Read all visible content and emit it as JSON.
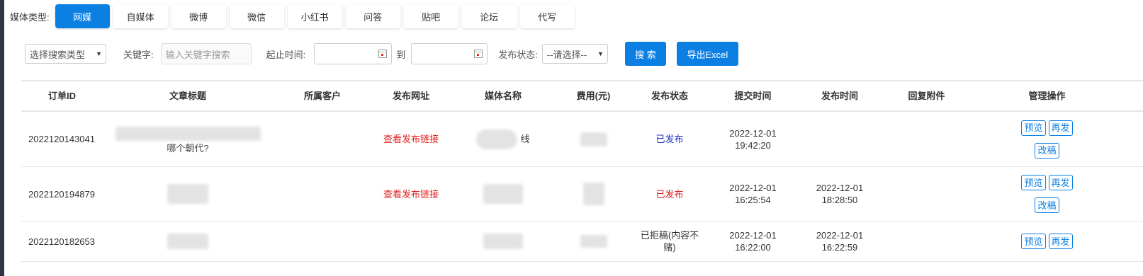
{
  "media": {
    "label": "媒体类型:",
    "tabs": [
      {
        "label": "网媒",
        "active": true
      },
      {
        "label": "自媒体"
      },
      {
        "label": "微博"
      },
      {
        "label": "微信"
      },
      {
        "label": "小红书"
      },
      {
        "label": "问答"
      },
      {
        "label": "贴吧"
      },
      {
        "label": "论坛"
      },
      {
        "label": "代写"
      }
    ]
  },
  "filters": {
    "search_type": "选择搜索类型",
    "keyword_label": "关键字:",
    "keyword_placeholder": "输入关键字搜索",
    "time_label": "起止时间:",
    "to_label": "到",
    "status_label": "发布状态:",
    "status_select": "--请选择--",
    "search_button": "搜 索",
    "export_button": "导出Excel"
  },
  "table": {
    "headers": [
      "订单ID",
      "文章标题",
      "所属客户",
      "发布网址",
      "媒体名称",
      "费用(元)",
      "发布状态",
      "提交时间",
      "发布时间",
      "回复附件",
      "管理操作"
    ],
    "rows": [
      {
        "id": "2022120143041",
        "title_fragment": "哪个朝代?",
        "url_link": "查看发布链接",
        "media_fragment": "线",
        "status": "已发布",
        "submit_date": "2022-12-01",
        "submit_time": "19:42:20",
        "publish_date": "",
        "publish_time": "",
        "ops": [
          "预览",
          "再发",
          "改稿"
        ]
      },
      {
        "id": "2022120194879",
        "title_fragment": "",
        "url_link": "查看发布链接",
        "media_fragment": "",
        "status": "已发布",
        "submit_date": "2022-12-01",
        "submit_time": "16:25:54",
        "publish_date": "2022-12-01",
        "publish_time": "18:28:50",
        "ops": [
          "预览",
          "再发",
          "改稿"
        ]
      },
      {
        "id": "2022120182653",
        "title_fragment": "",
        "url_link": "",
        "media_fragment": "",
        "status_line1": "已拒稿(内容不",
        "status_line2": "赌)",
        "submit_date": "2022-12-01",
        "submit_time": "16:22:00",
        "publish_date": "2022-12-01",
        "publish_time": "16:22:59",
        "ops": [
          "预览",
          "再发"
        ]
      }
    ]
  },
  "colors": {
    "accent": "#0c7fe3",
    "link_red": "#e01b1b",
    "status_blue": "#1f2fc7"
  }
}
